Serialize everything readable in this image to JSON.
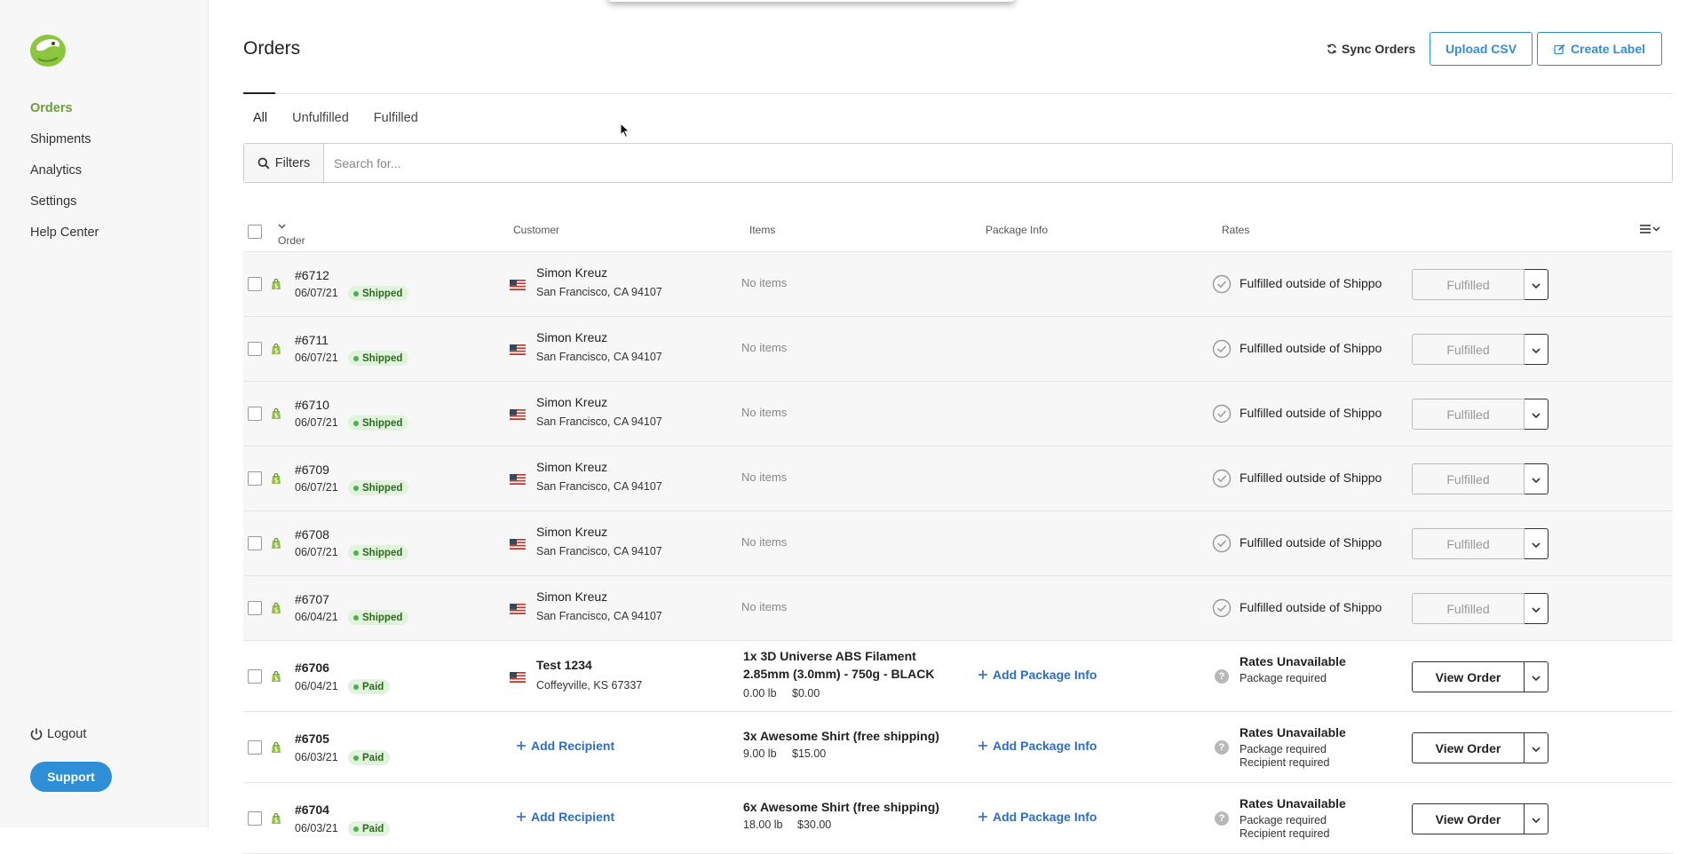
{
  "sidebar": {
    "items": [
      {
        "label": "Orders",
        "active": true
      },
      {
        "label": "Shipments",
        "active": false
      },
      {
        "label": "Analytics",
        "active": false
      },
      {
        "label": "Settings",
        "active": false
      },
      {
        "label": "Help Center",
        "active": false
      }
    ],
    "logout_label": "Logout",
    "support_label": "Support",
    "logo_icon": "shippo-logo",
    "accent_color": "#6aa03a"
  },
  "header": {
    "title": "Orders",
    "sync_label": "Sync Orders",
    "upload_label": "Upload CSV",
    "create_label": "Create Label"
  },
  "tabs": [
    {
      "label": "All",
      "active": true
    },
    {
      "label": "Unfulfilled",
      "active": false
    },
    {
      "label": "Fulfilled",
      "active": false
    }
  ],
  "search": {
    "filters_label": "Filters",
    "placeholder": "Search for..."
  },
  "table": {
    "columns": {
      "order": "Order",
      "customer": "Customer",
      "items": "Items",
      "package": "Package Info",
      "rates": "Rates"
    },
    "rows": [
      {
        "order": "#6712",
        "date": "06/07/21",
        "status": "Shipped",
        "customer_name": "Simon Kreuz",
        "customer_addr": "San Francisco, CA 94107",
        "items": "No items",
        "rate": "Fulfilled outside of Shippo",
        "action": "Fulfilled"
      },
      {
        "order": "#6711",
        "date": "06/07/21",
        "status": "Shipped",
        "customer_name": "Simon Kreuz",
        "customer_addr": "San Francisco, CA 94107",
        "items": "No items",
        "rate": "Fulfilled outside of Shippo",
        "action": "Fulfilled"
      },
      {
        "order": "#6710",
        "date": "06/07/21",
        "status": "Shipped",
        "customer_name": "Simon Kreuz",
        "customer_addr": "San Francisco, CA 94107",
        "items": "No items",
        "rate": "Fulfilled outside of Shippo",
        "action": "Fulfilled"
      },
      {
        "order": "#6709",
        "date": "06/07/21",
        "status": "Shipped",
        "customer_name": "Simon Kreuz",
        "customer_addr": "San Francisco, CA 94107",
        "items": "No items",
        "rate": "Fulfilled outside of Shippo",
        "action": "Fulfilled"
      },
      {
        "order": "#6708",
        "date": "06/07/21",
        "status": "Shipped",
        "customer_name": "Simon Kreuz",
        "customer_addr": "San Francisco, CA 94107",
        "items": "No items",
        "rate": "Fulfilled outside of Shippo",
        "action": "Fulfilled"
      },
      {
        "order": "#6707",
        "date": "06/04/21",
        "status": "Shipped",
        "customer_name": "Simon Kreuz",
        "customer_addr": "San Francisco, CA 94107",
        "items": "No items",
        "rate": "Fulfilled outside of Shippo",
        "action": "Fulfilled"
      }
    ],
    "paid_rows": [
      {
        "order": "#6706",
        "date": "06/04/21",
        "status": "Paid",
        "customer_name": "Test 1234",
        "customer_addr": "Coffeyville, KS 67337",
        "item_title": "1x 3D Universe ABS Filament 2.85mm (3.0mm) - 750g - BLACK",
        "item_weight": "0.00 lb",
        "item_price": "$0.00",
        "package_link": "Add Package Info",
        "rate_title": "Rates Unavailable",
        "rate_sub1": "Package required",
        "rate_sub2": "",
        "action": "View Order"
      },
      {
        "order": "#6705",
        "date": "06/03/21",
        "status": "Paid",
        "recipient_link": "Add Recipient",
        "item_title": "3x Awesome Shirt (free shipping)",
        "item_weight": "9.00 lb",
        "item_price": "$15.00",
        "package_link": "Add Package Info",
        "rate_title": "Rates Unavailable",
        "rate_sub1": "Package required",
        "rate_sub2": "Recipient required",
        "action": "View Order"
      },
      {
        "order": "#6704",
        "date": "06/03/21",
        "status": "Paid",
        "recipient_link": "Add Recipient",
        "item_title": "6x Awesome Shirt (free shipping)",
        "item_weight": "18.00 lb",
        "item_price": "$30.00",
        "package_link": "Add Package Info",
        "rate_title": "Rates Unavailable",
        "rate_sub1": "Package required",
        "rate_sub2": "Recipient required",
        "action": "View Order"
      }
    ]
  }
}
